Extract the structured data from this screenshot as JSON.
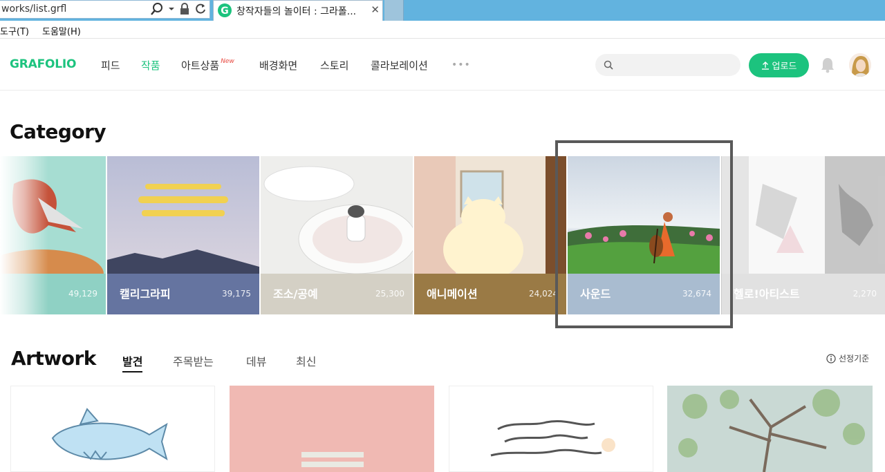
{
  "browser": {
    "address": "works/list.grfl",
    "tab_title": "창작자들의 놀이터 : 그라폴...",
    "tab_close": "✕",
    "menu": [
      "도구(T)",
      "도움말(H)"
    ]
  },
  "header": {
    "logo": "GRAFOLIO",
    "nav": [
      {
        "label": "피드",
        "active": false
      },
      {
        "label": "작품",
        "active": true
      },
      {
        "label": "아트상품",
        "badge": "New",
        "active": false
      },
      {
        "label": "배경화면",
        "active": false
      },
      {
        "label": "스토리",
        "active": false
      },
      {
        "label": "콜라보레이션",
        "active": false
      }
    ],
    "more": "•••",
    "search_placeholder": "",
    "upload_label": "업로드"
  },
  "category": {
    "title": "Category",
    "items": [
      {
        "name": "",
        "count": "49,129",
        "color": "#8fd1c4"
      },
      {
        "name": "캘리그라피",
        "count": "39,175",
        "color": "#6574a0"
      },
      {
        "name": "조소/공예",
        "count": "25,300",
        "color": "#d4d0c5"
      },
      {
        "name": "애니메이션",
        "count": "24,024",
        "color": "#9a7a45"
      },
      {
        "name": "사운드",
        "count": "32,674",
        "color": "#a9bcd0"
      },
      {
        "name": "헬로!아티스트",
        "count": "2,270",
        "color": "#c9c9c9"
      }
    ]
  },
  "artwork": {
    "title": "Artwork",
    "tabs": [
      {
        "label": "발견",
        "active": true
      },
      {
        "label": "주목받는",
        "active": false
      },
      {
        "label": "데뷰",
        "active": false
      },
      {
        "label": "최신",
        "active": false
      }
    ],
    "criteria_label": "선정기준",
    "brand_color": "#1cc37e"
  }
}
